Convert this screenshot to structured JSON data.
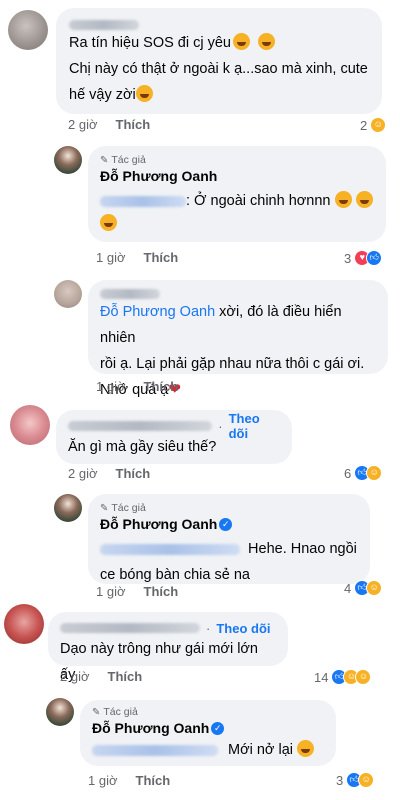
{
  "comments": [
    {
      "text_line1": "Ra tín hiệu SOS đi cj yêu",
      "text_line2": "Chị này có thật ở ngoài k ạ...sao mà xinh, cute",
      "text_line3": "hế vậy zời",
      "time": "2 giờ",
      "like": "Thích",
      "reaction_count": "2",
      "replies": [
        {
          "author_tag": "Tác giả",
          "author": "Đỗ Phương Oanh",
          "text": ": Ở ngoài chinh hơnnn",
          "time": "1 giờ",
          "like": "Thích",
          "reaction_count": "3"
        },
        {
          "author_mention": "Đỗ Phương Oanh",
          "text_line1": " xời, đó là điều hiển nhiên",
          "text_line2": "rồi ạ. Lại phải gặp nhau nữa thôi c gái ơi.",
          "text_line3": "Nhớ quá ạ",
          "time": "1 giờ",
          "like": "Thích"
        }
      ]
    },
    {
      "follow": "Theo dõi",
      "text": "Ăn gì mà gầy siêu thế?",
      "time": "2 giờ",
      "like": "Thích",
      "reaction_count": "6",
      "reply": {
        "author_tag": "Tác giả",
        "author": "Đỗ Phương Oanh",
        "text_line1": "Hehe. Hnao ngồi",
        "text_line2": "ce bóng bàn chia sẻ na",
        "time": "1 giờ",
        "like": "Thích",
        "reaction_count": "4"
      }
    },
    {
      "follow": "Theo dõi",
      "text": "Dạo này trông như gái mới lớn ấy",
      "time": "2 giờ",
      "like": "Thích",
      "reaction_count": "14",
      "reply": {
        "author_tag": "Tác giả",
        "author": "Đỗ Phương Oanh",
        "text": "Mới nở lại",
        "time": "1 giờ",
        "like": "Thích",
        "reaction_count": "3"
      }
    }
  ],
  "colors": {
    "bubble": "#f0f2f5",
    "link": "#1877f2",
    "meta": "#65676b"
  },
  "icons": [
    "pencil-icon",
    "verified-icon",
    "like-reaction-icon",
    "haha-reaction-icon",
    "heart-reaction-icon",
    "wow-reaction-icon"
  ]
}
